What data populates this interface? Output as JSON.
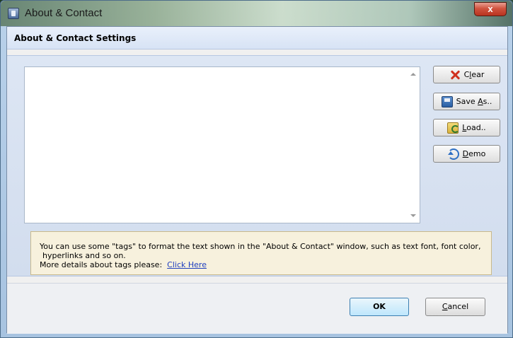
{
  "window": {
    "title": "About & Contact",
    "close_glyph": "x"
  },
  "header": {
    "title": "About & Contact Settings"
  },
  "editor": {
    "value": ""
  },
  "side_buttons": {
    "clear": {
      "pre": "C",
      "accel": "l",
      "post": "ear",
      "icon": "red-x-icon"
    },
    "save_as": {
      "pre": "Save ",
      "accel": "A",
      "post": "s..",
      "icon": "floppy-disk-icon"
    },
    "load": {
      "pre": "",
      "accel": "L",
      "post": "oad..",
      "icon": "folder-open-icon"
    },
    "demo": {
      "pre": "",
      "accel": "D",
      "post": "emo",
      "icon": "undo-arrow-icon"
    }
  },
  "hint": {
    "line1": "You can use some \"tags\" to format the text shown in the \"About & Contact\" window, such as text font, font color,",
    "line2": "hyperlinks and so on.",
    "line3_prefix": "More details about tags please:",
    "link_text": "Click Here"
  },
  "footer": {
    "ok_label": "OK",
    "cancel": {
      "pre": "",
      "accel": "C",
      "post": "ancel"
    }
  },
  "colors": {
    "hint_background": "#f7f1dd",
    "link": "#1f3fbf",
    "ok_border": "#3c7fb1"
  }
}
